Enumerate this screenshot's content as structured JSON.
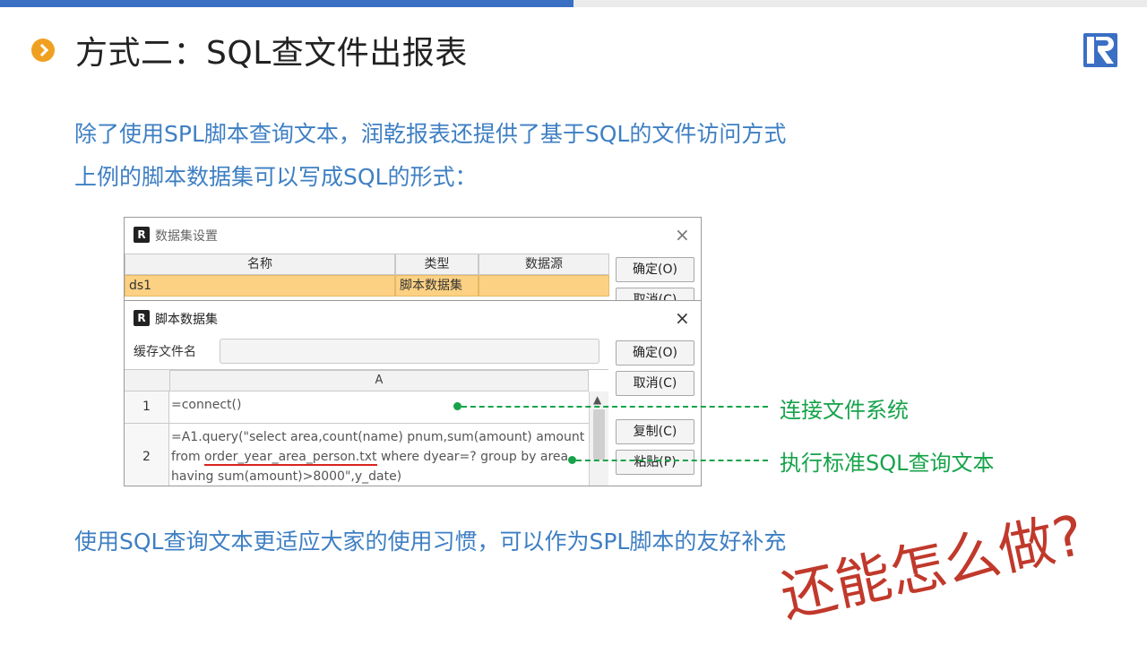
{
  "slide": {
    "title": "方式二：SQL查文件出报表",
    "line1": "除了使用SPL脚本查询文本，润乾报表还提供了基于SQL的文件访问方式",
    "line2": "上例的脚本数据集可以写成SQL的形式：",
    "line3": "使用SQL查询文本更适应大家的使用习惯，可以作为SPL脚本的友好补充",
    "handwriting": "还能怎么做?"
  },
  "colors": {
    "accent_blue": "#3a6fc4",
    "body_text": "#3e7fc3",
    "bullet": "#f0a020",
    "annotation": "#16a34a",
    "handwriting": "#c0392b",
    "selected_row": "#fcd183"
  },
  "dataset_dialog": {
    "title": "数据集设置",
    "icon": "R-app-icon",
    "close_icon": "close-icon",
    "columns": [
      "名称",
      "类型",
      "数据源"
    ],
    "rows": [
      {
        "name": "ds1",
        "type": "脚本数据集",
        "source": ""
      }
    ],
    "buttons": {
      "ok": "确定(O)",
      "cancel": "取消(C)"
    }
  },
  "script_dialog": {
    "title": "脚本数据集",
    "cache_label": "缓存文件名",
    "cache_value": "",
    "column_header": "A",
    "rows": [
      {
        "num": "1",
        "lines": [
          "=connect()"
        ]
      },
      {
        "num": "2",
        "lines": [
          "=A1.query(\"select area,count(name) pnum,sum(amount) amount",
          "from ",
          "order_year_area_person.txt",
          " where dyear=? group by area",
          "having sum(amount)>8000\",y_date)"
        ]
      }
    ],
    "buttons": {
      "ok": "确定(O)",
      "cancel": "取消(C)",
      "copy": "复制(C)",
      "paste": "粘贴(P)"
    }
  },
  "annotations": {
    "connect": "连接文件系统",
    "query": "执行标准SQL查询文本"
  }
}
